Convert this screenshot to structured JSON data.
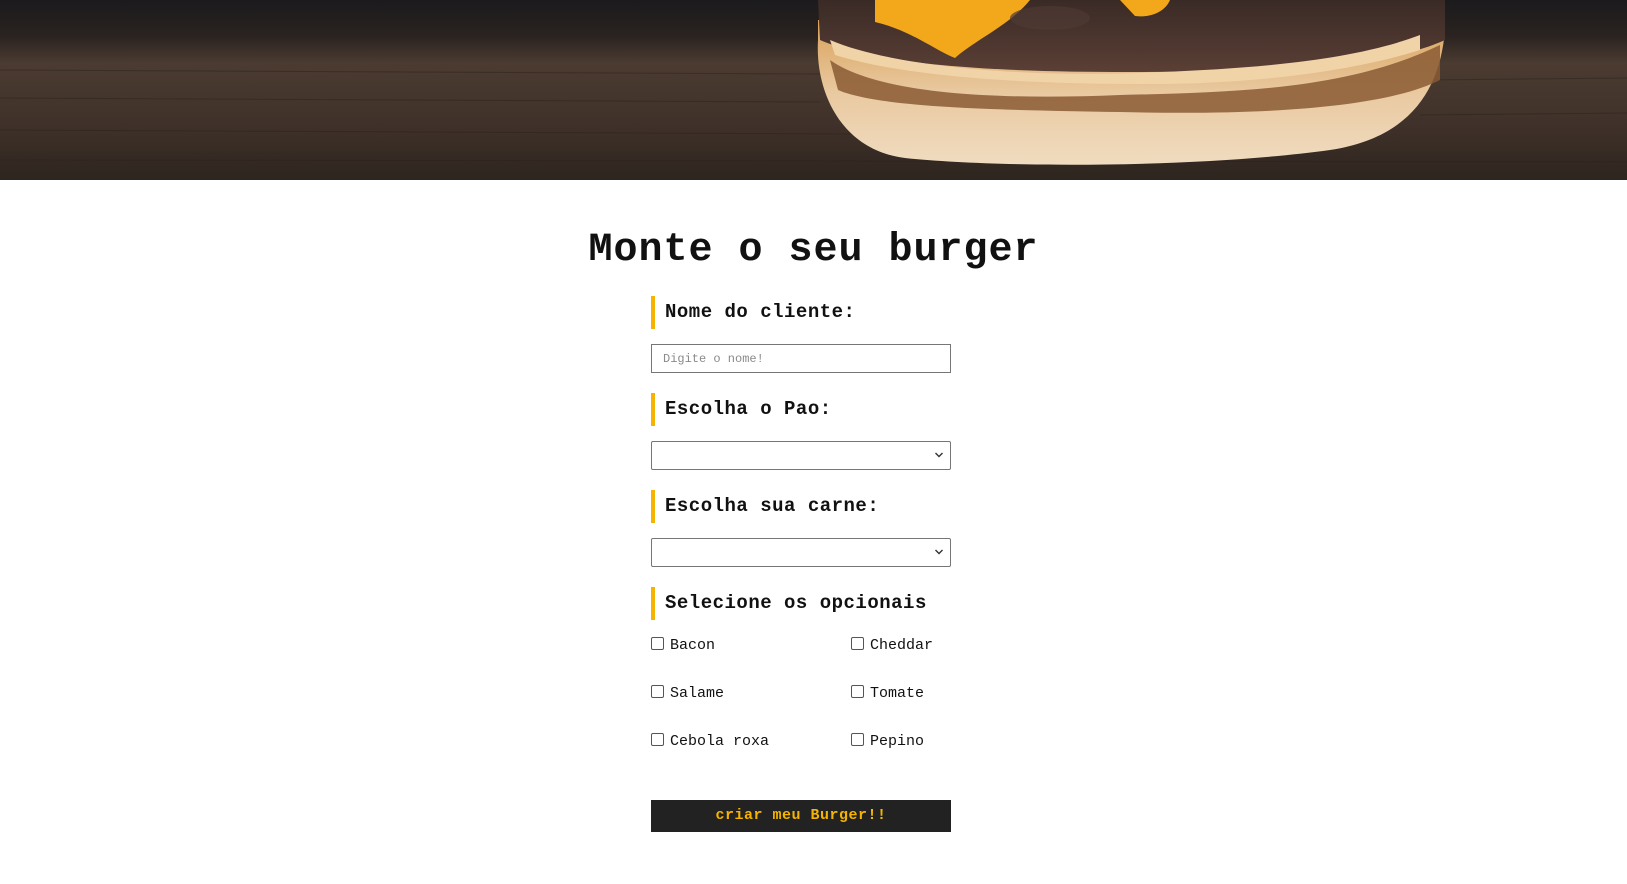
{
  "page": {
    "title": "Monte o seu burger"
  },
  "form": {
    "customer_name": {
      "label": "Nome do cliente:",
      "placeholder": "Digite o nome!",
      "value": ""
    },
    "bread": {
      "label": "Escolha o Pao:",
      "selected": ""
    },
    "meat": {
      "label": "Escolha sua carne:",
      "selected": ""
    },
    "optionals": {
      "label": "Selecione os opcionais",
      "items": [
        {
          "label": "Bacon",
          "checked": false
        },
        {
          "label": "Cheddar",
          "checked": false
        },
        {
          "label": "Salame",
          "checked": false
        },
        {
          "label": "Tomate",
          "checked": false
        },
        {
          "label": "Cebola roxa",
          "checked": false
        },
        {
          "label": "Pepino",
          "checked": false
        }
      ]
    },
    "submit_label": "criar meu Burger!!"
  },
  "colors": {
    "accent": "#f4b400",
    "button_bg": "#222222"
  }
}
